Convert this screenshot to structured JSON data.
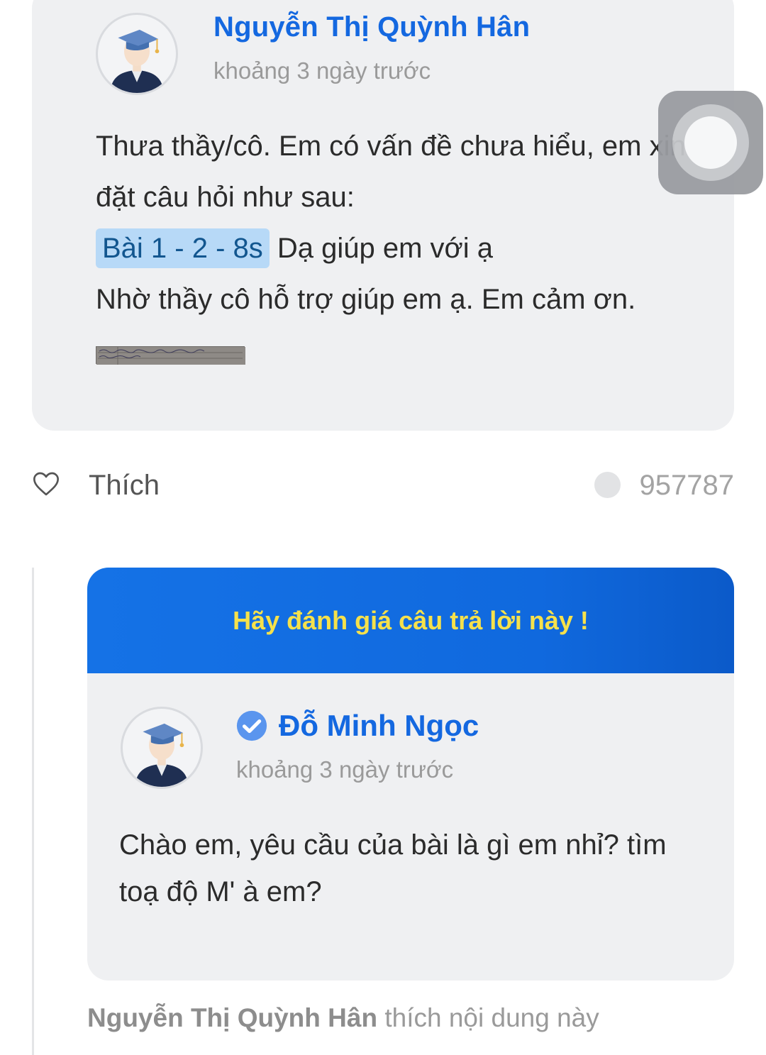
{
  "question": {
    "author": "Nguyễn Thị Quỳnh Hân",
    "time": "khoảng 3 ngày trước",
    "lines": [
      "Thưa thầy/cô. Em có vấn đề chưa hiểu, em xin đặt câu hỏi như sau:",
      "Dạ giúp em với ạ",
      "Nhờ thầy cô hỗ trợ giúp em ạ. Em cảm ơn."
    ],
    "tag": "Bài 1 - 2 - 8s"
  },
  "actions": {
    "like_label": "Thích",
    "count": "957787"
  },
  "answer": {
    "rate_banner": "Hãy đánh giá câu trả lời này !",
    "author": "Đỗ Minh Ngọc",
    "time": "khoảng 3 ngày trước",
    "body": "Chào em, yêu cầu của bài là gì em nhỉ? tìm toạ độ M' à em?"
  },
  "liked_by": {
    "name": "Nguyễn Thị Quỳnh Hân",
    "suffix": "thích nội dung này"
  },
  "colors": {
    "accent": "#1468e0",
    "banner": "#1069de",
    "banner_text": "#f6e14b",
    "card_bg": "#eff0f2",
    "tag_bg": "#b7d9f7"
  },
  "icons": [
    "heart-icon",
    "verified-icon",
    "graduate-avatar-icon",
    "assistive-touch-icon"
  ]
}
